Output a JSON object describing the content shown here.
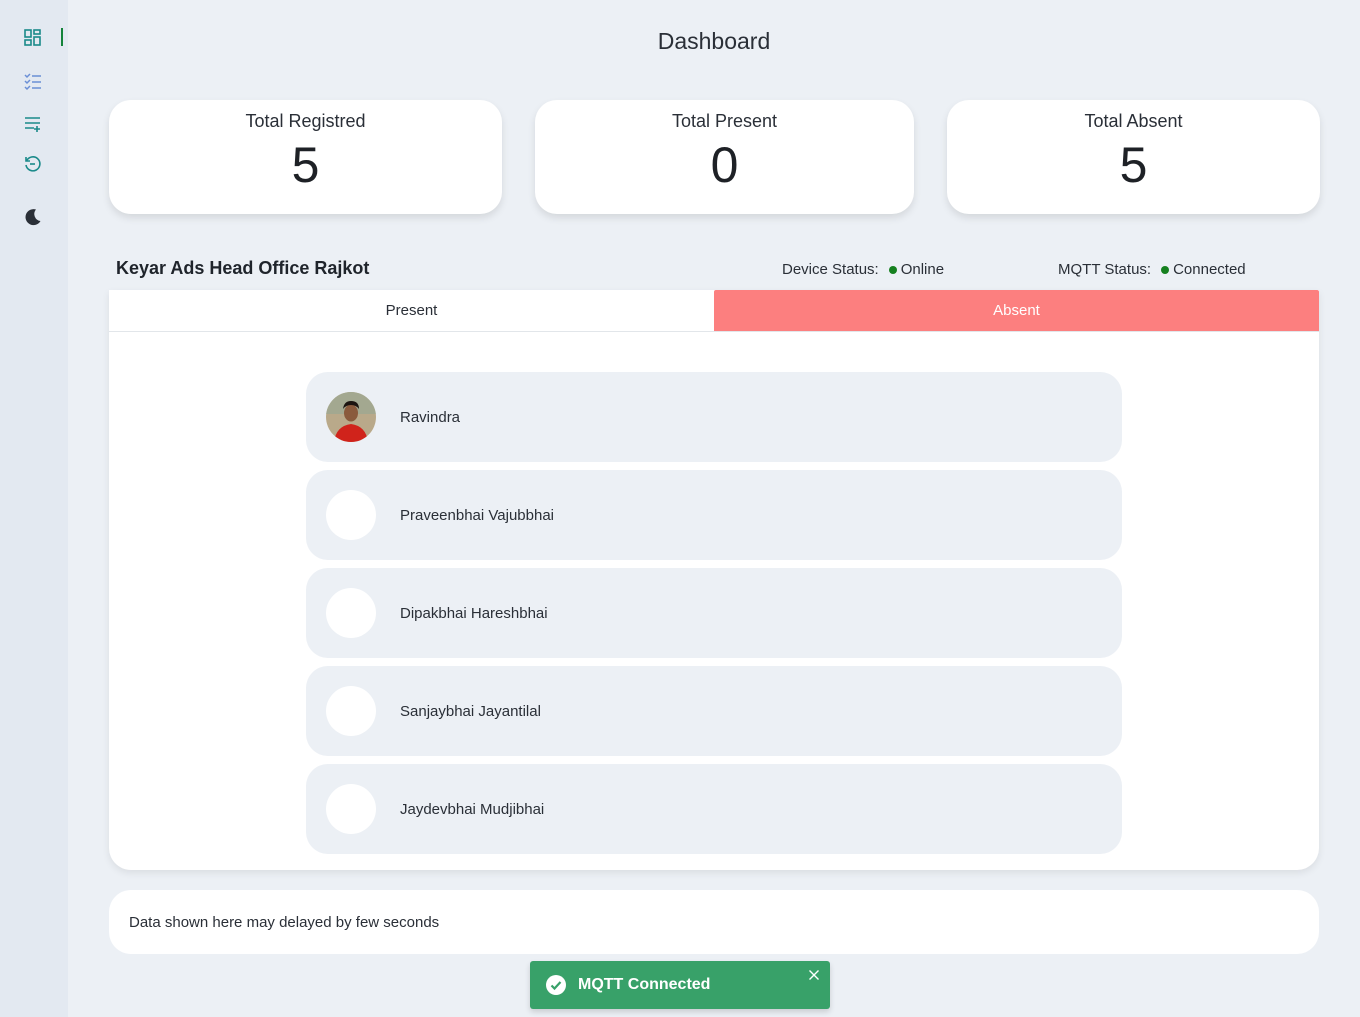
{
  "sidebar": {
    "icons": [
      "dashboard-icon",
      "checklist-icon",
      "add-list-icon",
      "history-icon",
      "moon-icon"
    ],
    "accent": "#14833a",
    "icon_color": "#1a8a8a"
  },
  "header": {
    "title": "Dashboard"
  },
  "stats": [
    {
      "label": "Total Registred",
      "value": "5"
    },
    {
      "label": "Total Present",
      "value": "0"
    },
    {
      "label": "Total Absent",
      "value": "5"
    }
  ],
  "office": {
    "name": "Keyar Ads Head Office Rajkot",
    "device_status_label": "Device Status:",
    "device_status_value": "Online",
    "mqtt_status_label": "MQTT Status:",
    "mqtt_status_value": "Connected",
    "status_color": "#15801f"
  },
  "tabs": [
    {
      "label": "Present",
      "active": false
    },
    {
      "label": "Absent",
      "active": true
    }
  ],
  "tab_active_color": "#fc7f7f",
  "people": [
    {
      "name": "Ravindra",
      "has_photo": true
    },
    {
      "name": "Praveenbhai Vajubbhai",
      "has_photo": false
    },
    {
      "name": "Dipakbhai Hareshbhai",
      "has_photo": false
    },
    {
      "name": "Sanjaybhai Jayantilal",
      "has_photo": false
    },
    {
      "name": "Jaydevbhai Mudjibhai",
      "has_photo": false
    }
  ],
  "note": "Data shown here may delayed by few seconds",
  "toast": {
    "text": "MQTT Connected",
    "color": "#38a169"
  }
}
